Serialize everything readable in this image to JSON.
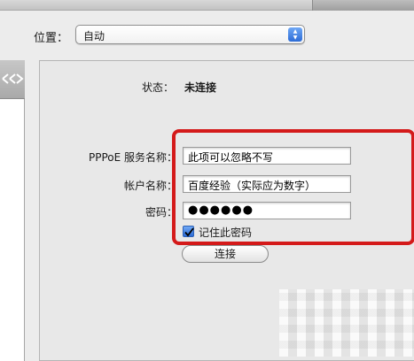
{
  "location": {
    "label": "位置：",
    "value": "自动"
  },
  "status": {
    "label": "状态：",
    "value": "未连接"
  },
  "pppoe": {
    "service_label": "PPPoE 服务名称：",
    "service_value": "此项可以忽略不写",
    "account_label": "帐户名称：",
    "account_value": "百度经验（实际应为数字）",
    "password_label": "密码：",
    "password_value": "●●●●●●",
    "remember_label": "记住此密码",
    "connect_label": "连接"
  },
  "colors": {
    "highlight": "#d41a1a",
    "accent": "#2c6bd6"
  }
}
